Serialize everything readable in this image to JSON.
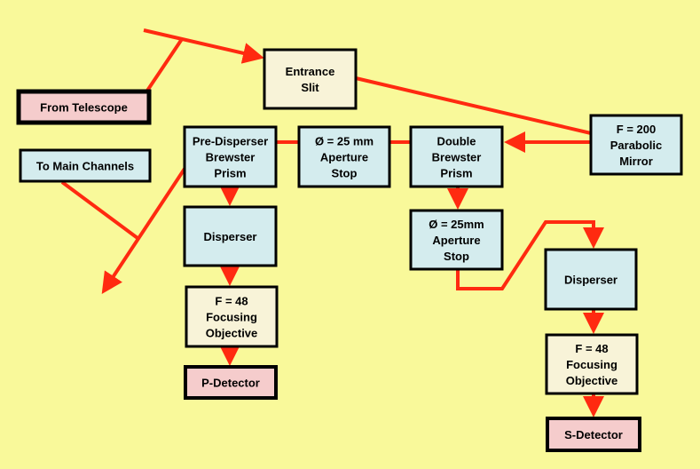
{
  "colors": {
    "background": "#f9f99a",
    "beam": "#ff2a10",
    "optics": "#d4ecee",
    "objective": "#f8f3d8",
    "endpoint": "#f5cccc"
  },
  "nodes": {
    "from_telescope": [
      "From Telescope"
    ],
    "to_main_channels": [
      "To Main Channels"
    ],
    "entrance_slit": [
      "Entrance",
      "Slit"
    ],
    "parabolic_mirror": [
      "F = 200",
      "Parabolic",
      "Mirror"
    ],
    "double_brewster": [
      "Double",
      "Brewster",
      "Prism"
    ],
    "aperture_stop_1": [
      "Ø = 25 mm",
      "Aperture",
      "Stop"
    ],
    "pre_disperser": [
      "Pre-Disperser",
      "Brewster",
      "Prism"
    ],
    "disperser_p": [
      "Disperser"
    ],
    "focusing_p": [
      "F = 48",
      "Focusing",
      "Objective"
    ],
    "p_detector": [
      "P-Detector"
    ],
    "aperture_stop_2": [
      "Ø = 25mm",
      "Aperture",
      "Stop"
    ],
    "disperser_s": [
      "Disperser"
    ],
    "focusing_s": [
      "F = 48",
      "Focusing",
      "Objective"
    ],
    "s_detector": [
      "S-Detector"
    ]
  }
}
